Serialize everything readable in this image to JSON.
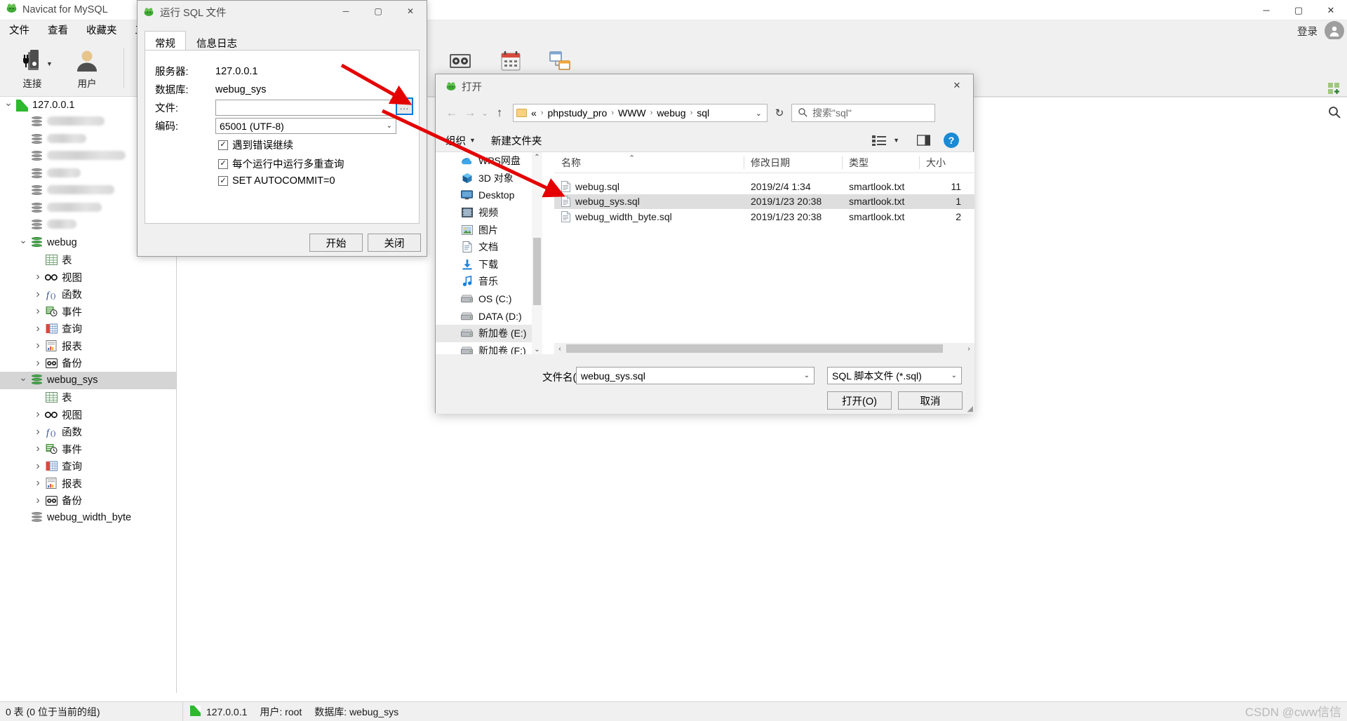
{
  "app": {
    "title": "Navicat for MySQL",
    "window_controls": {
      "minimize": "─",
      "maximize": "▢",
      "close": "✕"
    },
    "login_label": "登录"
  },
  "menubar": {
    "items": [
      "文件",
      "查看",
      "收藏夹",
      "工具"
    ]
  },
  "toolbar": {
    "items": [
      {
        "label": "连接",
        "icon": "connection-icon"
      },
      {
        "label": "用户",
        "icon": "user-icon"
      },
      {
        "label": "备份",
        "icon": "backup-icon"
      },
      {
        "label": "计划",
        "icon": "schedule-icon"
      },
      {
        "label": "模型",
        "icon": "model-icon"
      }
    ]
  },
  "tree": {
    "items": [
      {
        "label": "127.0.0.1",
        "icon": "connection-icon",
        "indent": 0,
        "chevron": "down",
        "selected": false,
        "blurred": false
      },
      {
        "label": "",
        "icon": "database-icon",
        "indent": 1,
        "chevron": "none",
        "selected": false,
        "blurred": true,
        "blur_width": 82
      },
      {
        "label": "",
        "icon": "database-icon",
        "indent": 1,
        "chevron": "none",
        "selected": false,
        "blurred": true,
        "blur_width": 56
      },
      {
        "label": "",
        "icon": "database-icon",
        "indent": 1,
        "chevron": "none",
        "selected": false,
        "blurred": true,
        "blur_width": 112
      },
      {
        "label": "",
        "icon": "database-icon",
        "indent": 1,
        "chevron": "none",
        "selected": false,
        "blurred": true,
        "blur_width": 48
      },
      {
        "label": "",
        "icon": "database-icon",
        "indent": 1,
        "chevron": "none",
        "selected": false,
        "blurred": true,
        "blur_width": 96
      },
      {
        "label": "",
        "icon": "database-icon",
        "indent": 1,
        "chevron": "none",
        "selected": false,
        "blurred": true,
        "blur_width": 78
      },
      {
        "label": "",
        "icon": "database-icon",
        "indent": 1,
        "chevron": "none",
        "selected": false,
        "blurred": true,
        "blur_width": 42
      },
      {
        "label": "webug",
        "icon": "database-green-icon",
        "indent": 1,
        "chevron": "down",
        "selected": false,
        "blurred": false
      },
      {
        "label": "表",
        "icon": "table-icon",
        "indent": 2,
        "chevron": "none",
        "selected": false,
        "blurred": false
      },
      {
        "label": "视图",
        "icon": "view-icon",
        "indent": 2,
        "chevron": "right",
        "selected": false,
        "blurred": false
      },
      {
        "label": "函数",
        "icon": "function-icon",
        "indent": 2,
        "chevron": "right",
        "selected": false,
        "blurred": false
      },
      {
        "label": "事件",
        "icon": "event-icon",
        "indent": 2,
        "chevron": "right",
        "selected": false,
        "blurred": false
      },
      {
        "label": "查询",
        "icon": "query-icon",
        "indent": 2,
        "chevron": "right",
        "selected": false,
        "blurred": false
      },
      {
        "label": "报表",
        "icon": "report-icon",
        "indent": 2,
        "chevron": "right",
        "selected": false,
        "blurred": false
      },
      {
        "label": "备份",
        "icon": "backup-icon",
        "indent": 2,
        "chevron": "right",
        "selected": false,
        "blurred": false
      },
      {
        "label": "webug_sys",
        "icon": "database-green-icon",
        "indent": 1,
        "chevron": "down",
        "selected": true,
        "blurred": false
      },
      {
        "label": "表",
        "icon": "table-icon",
        "indent": 2,
        "chevron": "none",
        "selected": false,
        "blurred": false
      },
      {
        "label": "视图",
        "icon": "view-icon",
        "indent": 2,
        "chevron": "right",
        "selected": false,
        "blurred": false
      },
      {
        "label": "函数",
        "icon": "function-icon",
        "indent": 2,
        "chevron": "right",
        "selected": false,
        "blurred": false
      },
      {
        "label": "事件",
        "icon": "event-icon",
        "indent": 2,
        "chevron": "right",
        "selected": false,
        "blurred": false
      },
      {
        "label": "查询",
        "icon": "query-icon",
        "indent": 2,
        "chevron": "right",
        "selected": false,
        "blurred": false
      },
      {
        "label": "报表",
        "icon": "report-icon",
        "indent": 2,
        "chevron": "right",
        "selected": false,
        "blurred": false
      },
      {
        "label": "备份",
        "icon": "backup-icon",
        "indent": 2,
        "chevron": "right",
        "selected": false,
        "blurred": false
      },
      {
        "label": "webug_width_byte",
        "icon": "database-icon",
        "indent": 1,
        "chevron": "none",
        "selected": false,
        "blurred": false
      }
    ]
  },
  "statusbar": {
    "left": "0 表 (0 位于当前的组)",
    "host": "127.0.0.1",
    "user": "用户: root",
    "database": "数据库: webug_sys"
  },
  "watermark": "CSDN @cww信信",
  "run_sql_dialog": {
    "title": "运行 SQL 文件",
    "window_controls": {
      "minimize": "─",
      "maximize": "▢",
      "close": "✕"
    },
    "tabs": [
      {
        "label": "常规",
        "active": true
      },
      {
        "label": "信息日志",
        "active": false
      }
    ],
    "fields": [
      {
        "label": "服务器:",
        "value": "127.0.0.1",
        "type": "text"
      },
      {
        "label": "数据库:",
        "value": "webug_sys",
        "type": "text"
      },
      {
        "label": "文件:",
        "value": "",
        "type": "input"
      },
      {
        "label": "编码:",
        "value": "65001 (UTF-8)",
        "type": "combo"
      }
    ],
    "browse_button": "...",
    "checkboxes": [
      {
        "label": "遇到错误继续",
        "checked": true
      },
      {
        "label": "每个运行中运行多重查询",
        "checked": true
      },
      {
        "label": "SET AUTOCOMMIT=0",
        "checked": true
      }
    ],
    "buttons": {
      "start": "开始",
      "close": "关闭"
    }
  },
  "open_dialog": {
    "title": "打开",
    "close": "✕",
    "nav": {
      "back": "←",
      "forward": "→",
      "recent": "⌄",
      "up": "↑"
    },
    "breadcrumb": {
      "prefix": "«",
      "parts": [
        "phpstudy_pro",
        "WWW",
        "webug",
        "sql"
      ],
      "dropdown": "⌄"
    },
    "refresh": "↻",
    "search_placeholder": "搜索\"sql\"",
    "toolbar": {
      "organize": "组织",
      "organize_arrow": "▼",
      "new_folder": "新建文件夹",
      "help": "?"
    },
    "places": [
      {
        "label": "WPS网盘",
        "icon": "cloud-icon",
        "selected": false
      },
      {
        "label": "3D 对象",
        "icon": "3d-object-icon",
        "selected": false
      },
      {
        "label": "Desktop",
        "icon": "desktop-icon",
        "selected": false
      },
      {
        "label": "视频",
        "icon": "video-icon",
        "selected": false
      },
      {
        "label": "图片",
        "icon": "picture-icon",
        "selected": false
      },
      {
        "label": "文档",
        "icon": "document-icon",
        "selected": false
      },
      {
        "label": "下载",
        "icon": "download-icon",
        "selected": false
      },
      {
        "label": "音乐",
        "icon": "music-icon",
        "selected": false
      },
      {
        "label": "OS (C:)",
        "icon": "drive-icon",
        "selected": false
      },
      {
        "label": "DATA (D:)",
        "icon": "drive-icon",
        "selected": false
      },
      {
        "label": "新加卷 (E:)",
        "icon": "drive-icon",
        "selected": true
      },
      {
        "label": "新加卷 (F:)",
        "icon": "drive-icon",
        "selected": false
      }
    ],
    "columns": [
      "名称",
      "修改日期",
      "类型",
      "大小"
    ],
    "files": [
      {
        "name": "webug.sql",
        "modified": "2019/2/4 1:34",
        "type": "smartlook.txt",
        "size": "11",
        "selected": false
      },
      {
        "name": "webug_sys.sql",
        "modified": "2019/1/23 20:38",
        "type": "smartlook.txt",
        "size": "1",
        "selected": true
      },
      {
        "name": "webug_width_byte.sql",
        "modified": "2019/1/23 20:38",
        "type": "smartlook.txt",
        "size": "2",
        "selected": false
      }
    ],
    "filename_label": "文件名(N):",
    "filename_value": "webug_sys.sql",
    "filetype_value": "SQL 脚本文件 (*.sql)",
    "buttons": {
      "open": "打开(O)",
      "cancel": "取消"
    }
  }
}
